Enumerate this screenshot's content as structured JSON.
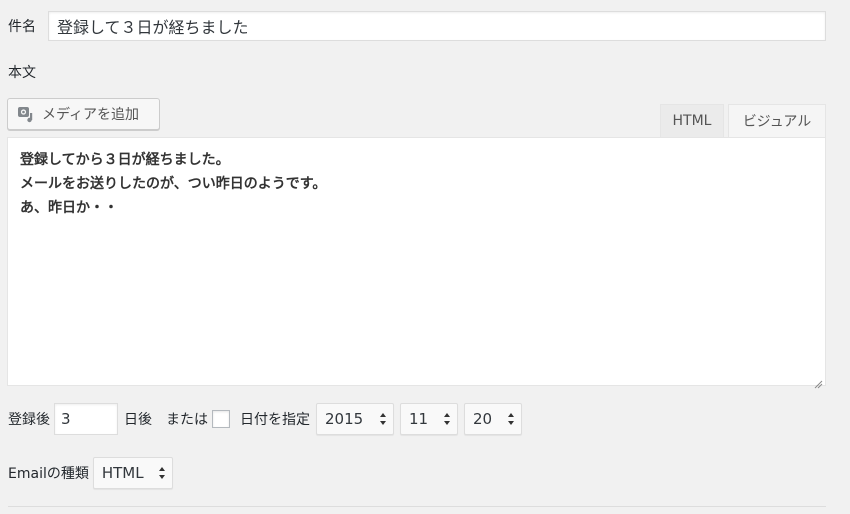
{
  "form": {
    "subject_label": "件名",
    "subject_value": "登録して３日が経ちました",
    "body_label": "本文"
  },
  "toolbar": {
    "media_button_label": "メディアを追加",
    "media_icon": "media-camera-icon"
  },
  "editor": {
    "tabs": [
      {
        "label": "HTML",
        "active": false
      },
      {
        "label": "ビジュアル",
        "active": true
      }
    ],
    "lines": [
      "登録してから３日が経ちました。",
      "メールをお送りしたのが、つい昨日のようです。",
      "あ、昨日か・・"
    ]
  },
  "schedule": {
    "after_label": "登録後",
    "days_value": "3",
    "days_suffix": "日後",
    "or_label": "または",
    "date_checkbox_label": "日付を指定",
    "date_checked": false,
    "year": "2015",
    "month": "11",
    "day": "20"
  },
  "email_type": {
    "label": "Emailの種類",
    "value": "HTML"
  },
  "colors": {
    "background": "#f1f1f1",
    "border": "#dddddd",
    "text": "#23282d"
  }
}
